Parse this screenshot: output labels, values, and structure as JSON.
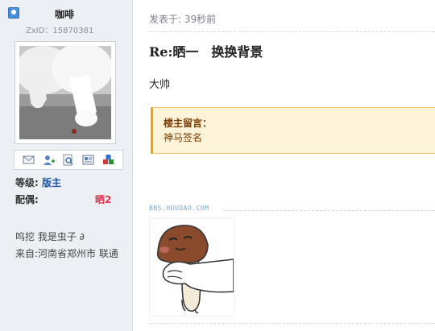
{
  "user": {
    "name": "咖啡",
    "zxid_label": "ZxID：",
    "zxid_value": "15870381"
  },
  "profile": {
    "rank_label": "等级:",
    "rank_value": "版主",
    "spouse_label": "配偶:",
    "spouse_value": "晒2",
    "signature_line1": "呜挖 我是虫子 ∂",
    "signature_line2": "来自:河南省郑州市 联通"
  },
  "toolbar": {
    "icons": [
      "mail-icon",
      "add-friend-icon",
      "view-profile-icon",
      "card-icon",
      "blocks-icon"
    ]
  },
  "post": {
    "time": "发表于: 39秒前",
    "title": "Re:晒一　换换背景",
    "body": "大帅",
    "notice_title": "楼主留言：",
    "notice_text": "神马签名",
    "bbs_link": "BBS.HOUDAO.COM"
  },
  "colors": {
    "rank": "#1b54a8",
    "spouse": "#e6324b",
    "notice_bg": "#fdf3d9",
    "notice_border": "#f2a300"
  }
}
